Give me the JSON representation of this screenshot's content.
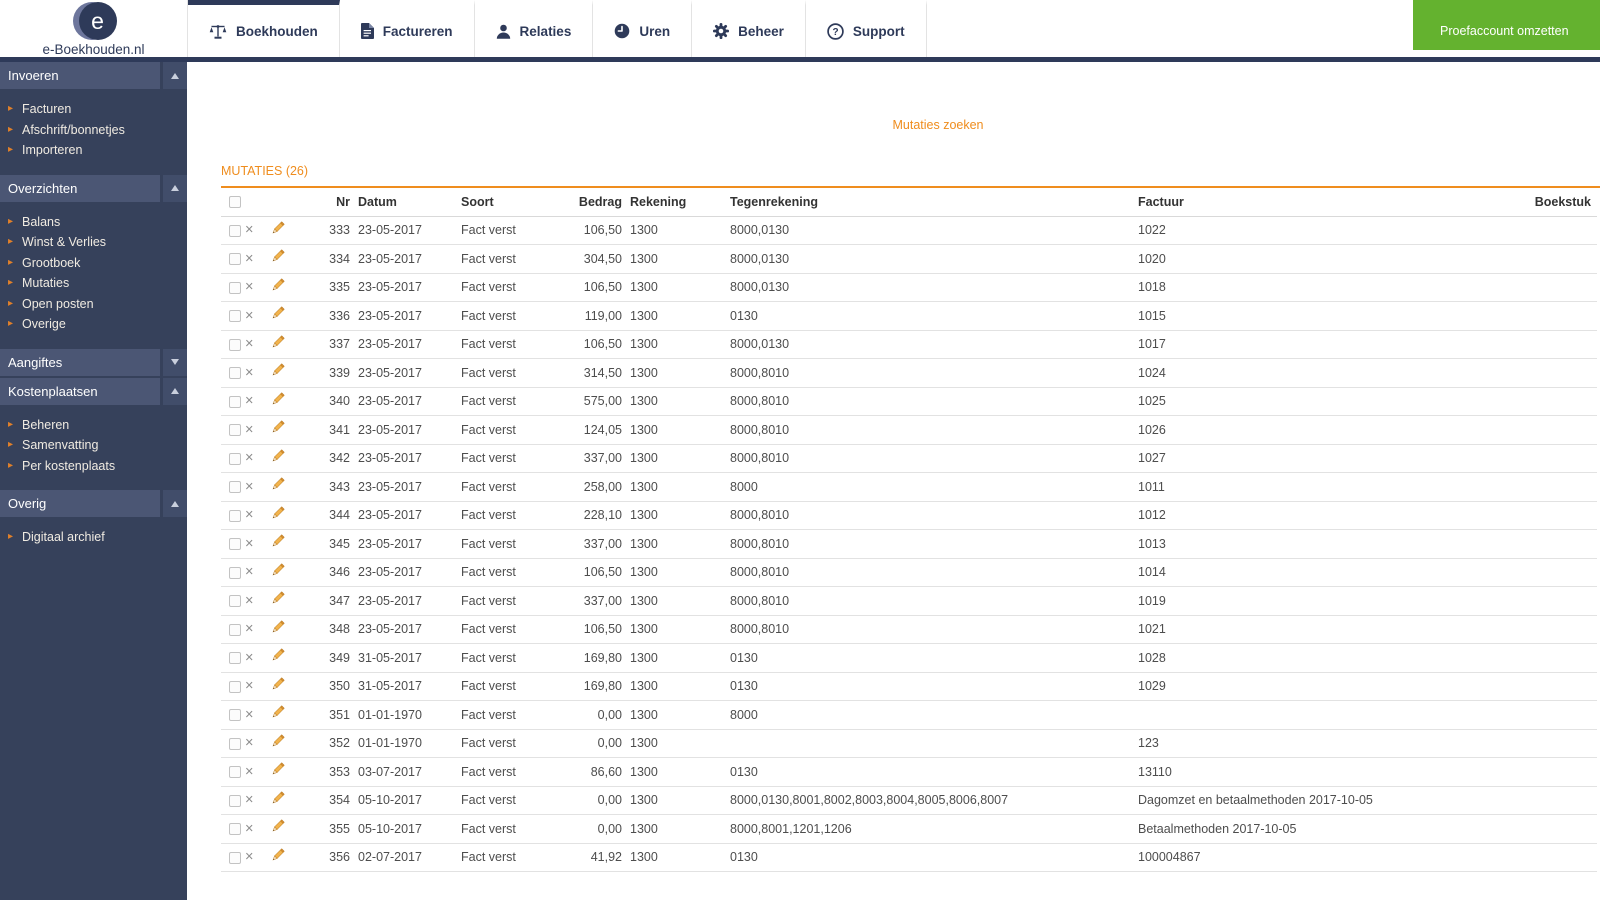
{
  "header": {
    "logo_text": "e-Boekhouden.nl",
    "logo_letter": "e",
    "tabs": [
      {
        "label": "Boekhouden",
        "icon": "scale-icon",
        "active": true
      },
      {
        "label": "Factureren",
        "icon": "document-icon",
        "active": false
      },
      {
        "label": "Relaties",
        "icon": "person-icon",
        "active": false
      },
      {
        "label": "Uren",
        "icon": "clock-icon",
        "active": false
      },
      {
        "label": "Beheer",
        "icon": "gear-icon",
        "active": false
      },
      {
        "label": "Support",
        "icon": "question-icon",
        "active": false
      }
    ],
    "cta_label": "Proefaccount omzetten"
  },
  "sidebar": {
    "sections": [
      {
        "title": "Invoeren",
        "expanded": true,
        "items": [
          "Facturen",
          "Afschrift/bonnetjes",
          "Importeren"
        ]
      },
      {
        "title": "Overzichten",
        "expanded": true,
        "items": [
          "Balans",
          "Winst & Verlies",
          "Grootboek",
          "Mutaties",
          "Open posten",
          "Overige"
        ]
      },
      {
        "title": "Aangiftes",
        "expanded": false,
        "items": []
      },
      {
        "title": "Kostenplaatsen",
        "expanded": true,
        "items": [
          "Beheren",
          "Samenvatting",
          "Per kostenplaats"
        ]
      },
      {
        "title": "Overig",
        "expanded": true,
        "items": [
          "Digitaal archief"
        ]
      }
    ]
  },
  "main": {
    "search_link": "Mutaties zoeken",
    "panel_title": "MUTATIES (26)",
    "table": {
      "columns": [
        "Nr",
        "Datum",
        "Soort",
        "Bedrag",
        "Rekening",
        "Tegenrekening",
        "Factuur",
        "Boekstuk"
      ],
      "rows": [
        {
          "nr": "333",
          "datum": "23-05-2017",
          "soort": "Fact verst",
          "bedrag": "106,50",
          "rekening": "1300",
          "tegenrekening": "8000,0130",
          "factuur": "1022",
          "boekstuk": ""
        },
        {
          "nr": "334",
          "datum": "23-05-2017",
          "soort": "Fact verst",
          "bedrag": "304,50",
          "rekening": "1300",
          "tegenrekening": "8000,0130",
          "factuur": "1020",
          "boekstuk": ""
        },
        {
          "nr": "335",
          "datum": "23-05-2017",
          "soort": "Fact verst",
          "bedrag": "106,50",
          "rekening": "1300",
          "tegenrekening": "8000,0130",
          "factuur": "1018",
          "boekstuk": ""
        },
        {
          "nr": "336",
          "datum": "23-05-2017",
          "soort": "Fact verst",
          "bedrag": "119,00",
          "rekening": "1300",
          "tegenrekening": "0130",
          "factuur": "1015",
          "boekstuk": ""
        },
        {
          "nr": "337",
          "datum": "23-05-2017",
          "soort": "Fact verst",
          "bedrag": "106,50",
          "rekening": "1300",
          "tegenrekening": "8000,0130",
          "factuur": "1017",
          "boekstuk": ""
        },
        {
          "nr": "339",
          "datum": "23-05-2017",
          "soort": "Fact verst",
          "bedrag": "314,50",
          "rekening": "1300",
          "tegenrekening": "8000,8010",
          "factuur": "1024",
          "boekstuk": ""
        },
        {
          "nr": "340",
          "datum": "23-05-2017",
          "soort": "Fact verst",
          "bedrag": "575,00",
          "rekening": "1300",
          "tegenrekening": "8000,8010",
          "factuur": "1025",
          "boekstuk": ""
        },
        {
          "nr": "341",
          "datum": "23-05-2017",
          "soort": "Fact verst",
          "bedrag": "124,05",
          "rekening": "1300",
          "tegenrekening": "8000,8010",
          "factuur": "1026",
          "boekstuk": ""
        },
        {
          "nr": "342",
          "datum": "23-05-2017",
          "soort": "Fact verst",
          "bedrag": "337,00",
          "rekening": "1300",
          "tegenrekening": "8000,8010",
          "factuur": "1027",
          "boekstuk": ""
        },
        {
          "nr": "343",
          "datum": "23-05-2017",
          "soort": "Fact verst",
          "bedrag": "258,00",
          "rekening": "1300",
          "tegenrekening": "8000",
          "factuur": "1011",
          "boekstuk": ""
        },
        {
          "nr": "344",
          "datum": "23-05-2017",
          "soort": "Fact verst",
          "bedrag": "228,10",
          "rekening": "1300",
          "tegenrekening": "8000,8010",
          "factuur": "1012",
          "boekstuk": ""
        },
        {
          "nr": "345",
          "datum": "23-05-2017",
          "soort": "Fact verst",
          "bedrag": "337,00",
          "rekening": "1300",
          "tegenrekening": "8000,8010",
          "factuur": "1013",
          "boekstuk": ""
        },
        {
          "nr": "346",
          "datum": "23-05-2017",
          "soort": "Fact verst",
          "bedrag": "106,50",
          "rekening": "1300",
          "tegenrekening": "8000,8010",
          "factuur": "1014",
          "boekstuk": ""
        },
        {
          "nr": "347",
          "datum": "23-05-2017",
          "soort": "Fact verst",
          "bedrag": "337,00",
          "rekening": "1300",
          "tegenrekening": "8000,8010",
          "factuur": "1019",
          "boekstuk": ""
        },
        {
          "nr": "348",
          "datum": "23-05-2017",
          "soort": "Fact verst",
          "bedrag": "106,50",
          "rekening": "1300",
          "tegenrekening": "8000,8010",
          "factuur": "1021",
          "boekstuk": ""
        },
        {
          "nr": "349",
          "datum": "31-05-2017",
          "soort": "Fact verst",
          "bedrag": "169,80",
          "rekening": "1300",
          "tegenrekening": "0130",
          "factuur": "1028",
          "boekstuk": ""
        },
        {
          "nr": "350",
          "datum": "31-05-2017",
          "soort": "Fact verst",
          "bedrag": "169,80",
          "rekening": "1300",
          "tegenrekening": "0130",
          "factuur": "1029",
          "boekstuk": ""
        },
        {
          "nr": "351",
          "datum": "01-01-1970",
          "soort": "Fact verst",
          "bedrag": "0,00",
          "rekening": "1300",
          "tegenrekening": "8000",
          "factuur": "",
          "boekstuk": ""
        },
        {
          "nr": "352",
          "datum": "01-01-1970",
          "soort": "Fact verst",
          "bedrag": "0,00",
          "rekening": "1300",
          "tegenrekening": "",
          "factuur": "123",
          "boekstuk": ""
        },
        {
          "nr": "353",
          "datum": "03-07-2017",
          "soort": "Fact verst",
          "bedrag": "86,60",
          "rekening": "1300",
          "tegenrekening": "0130",
          "factuur": "13110",
          "boekstuk": ""
        },
        {
          "nr": "354",
          "datum": "05-10-2017",
          "soort": "Fact verst",
          "bedrag": "0,00",
          "rekening": "1300",
          "tegenrekening": "8000,0130,8001,8002,8003,8004,8005,8006,8007",
          "factuur": "Dagomzet en betaalmethoden 2017-10-05",
          "boekstuk": ""
        },
        {
          "nr": "355",
          "datum": "05-10-2017",
          "soort": "Fact verst",
          "bedrag": "0,00",
          "rekening": "1300",
          "tegenrekening": "8000,8001,1201,1206",
          "factuur": "Betaalmethoden 2017-10-05",
          "boekstuk": ""
        },
        {
          "nr": "356",
          "datum": "02-07-2017",
          "soort": "Fact verst",
          "bedrag": "41,92",
          "rekening": "1300",
          "tegenrekening": "0130",
          "factuur": "100004867",
          "boekstuk": ""
        }
      ]
    }
  },
  "colors": {
    "navy": "#2e3a59",
    "sidebar_bg": "#36415b",
    "sidebar_bar_bg": "#4b5674",
    "accent_orange": "#ef8d1e",
    "cta_green": "#64b22f"
  }
}
